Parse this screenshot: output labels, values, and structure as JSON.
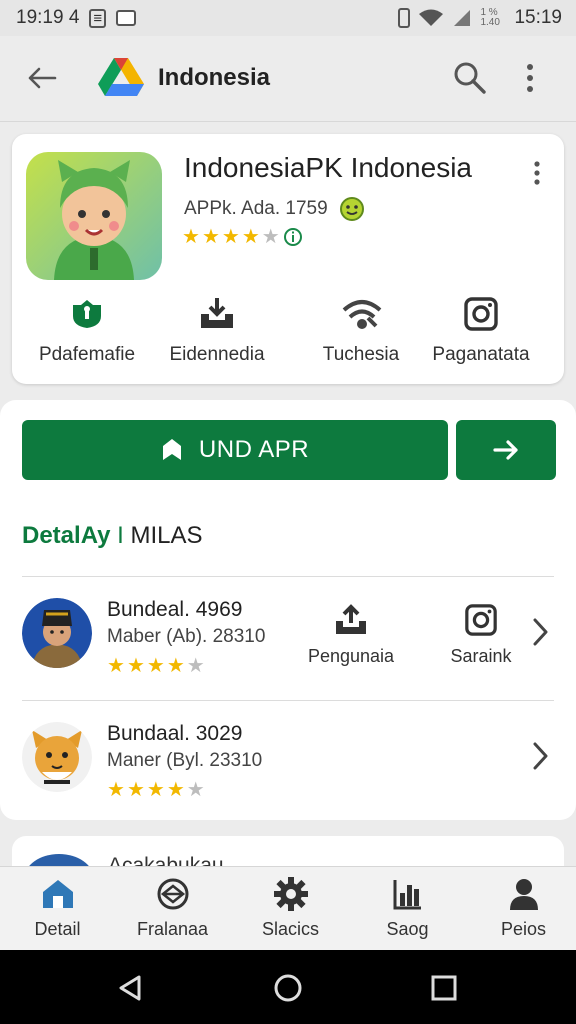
{
  "status_bar": {
    "time_left": "19:19 4",
    "small_text": "1 %\n1.40",
    "time_right": "15:19"
  },
  "app_bar": {
    "title": "Indonesia",
    "icons": [
      "back-arrow-icon",
      "drive-logo",
      "search-icon",
      "more-vert-icon"
    ]
  },
  "app": {
    "name": "IndonesiaPK Indonesia",
    "meta": "APPk. Ada. 1759",
    "rating": 4,
    "actions": [
      {
        "label": "Pdafemafie",
        "icon": "shield-badge-icon"
      },
      {
        "label": "Eidennedia",
        "icon": "download-tray-icon"
      },
      {
        "label": "Tuchesia",
        "icon": "wifi-signal-icon"
      },
      {
        "label": "Paganatata",
        "icon": "instagram-icon"
      }
    ]
  },
  "primary_button": {
    "label": "UND APR"
  },
  "section": {
    "title_green": "DetalAy",
    "separator": "I",
    "title_rest": "MILAS"
  },
  "list": [
    {
      "name": "Bundeal. 4969",
      "sub": "Maber (Ab). 28310",
      "rating": 4,
      "actions": [
        {
          "label": "Pengunaia",
          "icon": "upload-tray-icon"
        },
        {
          "label": "Saraink",
          "icon": "instagram-icon"
        }
      ]
    },
    {
      "name": "Bundaal. 3029",
      "sub": "Maner (Byl. 23310",
      "rating": 4
    }
  ],
  "peek_item": {
    "text": "Acakabukau"
  },
  "bottom_nav": [
    {
      "label": "Detail",
      "icon": "home-icon",
      "active": true
    },
    {
      "label": "Fralanaa",
      "icon": "compass-icon"
    },
    {
      "label": "Slacics",
      "icon": "gear-icon"
    },
    {
      "label": "Saog",
      "icon": "chart-icon"
    },
    {
      "label": "Peios",
      "icon": "person-icon"
    }
  ],
  "colors": {
    "primary": "#0d7a3e",
    "star": "#f2b800",
    "star_off": "#bdbdbd"
  }
}
